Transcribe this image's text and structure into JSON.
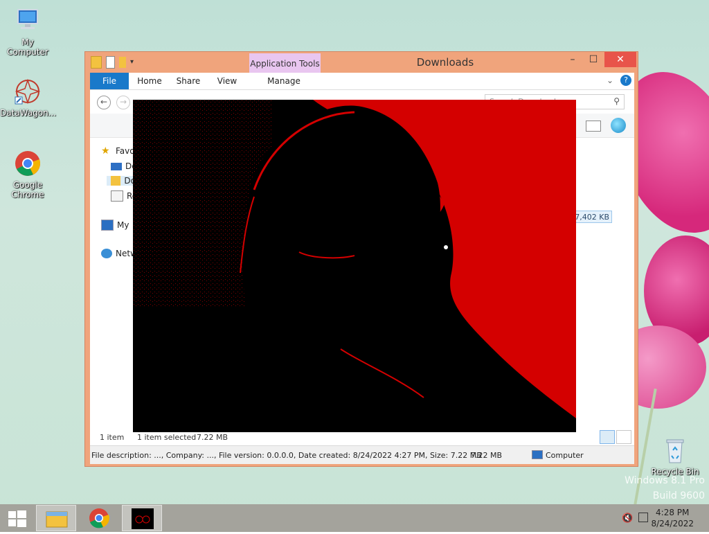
{
  "desktop": {
    "icons": [
      {
        "label": "My Computer",
        "icon": "computer-icon"
      },
      {
        "label": "DataWagon...",
        "icon": "datawagon-icon"
      },
      {
        "label": "Google Chrome",
        "icon": "chrome-icon"
      },
      {
        "label": "Recycle Bin",
        "icon": "recycle-bin-icon"
      }
    ],
    "watermark_line1": "Windows 8.1 Pro",
    "watermark_line2": "Build 9600"
  },
  "explorer": {
    "title": "Downloads",
    "context_tab": "Application Tools",
    "ribbon_tabs": [
      "File",
      "Home",
      "Share",
      "View",
      "Manage"
    ],
    "search_placeholder": "Search Downloads",
    "nav": {
      "favorites": "Favorites",
      "desktop": "De",
      "downloads": "Do",
      "recent": "Re",
      "my_computer": "My",
      "network": "Netw"
    },
    "selected_size": "7,402 KB",
    "status": {
      "items": "1 item",
      "selected": "1 item selected",
      "selected_size": "7.22 MB"
    },
    "details": {
      "description": "File description: ..., Company: ..., File version: 0.0.0.0, Date created: 8/24/2022 4:27 PM, Size: 7.22 MB",
      "size": "7.22 MB",
      "location": "Computer"
    }
  },
  "taskbar": {
    "apps": [
      "start-button",
      "file-explorer-icon",
      "chrome-icon",
      "photo-app-icon"
    ],
    "time": "4:28 PM",
    "date": "8/24/2022",
    "tray_icons": [
      "volume-muted-icon",
      "network-icon"
    ]
  },
  "colors": {
    "window_frame": "#f0a47c",
    "file_tab": "#1979ca",
    "context_tab": "#e9c6f0",
    "photo_red": "#d40000"
  }
}
